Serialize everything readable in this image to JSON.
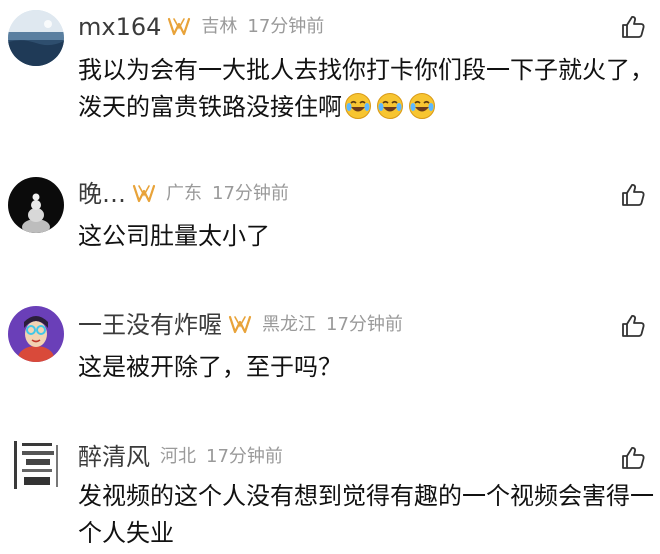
{
  "comments": [
    {
      "username": "mx164",
      "location": "吉林",
      "time": "17分钟前",
      "text": "我以为会有一大批人去找你打卡你们段一下子就火了，泼天的富贵铁路没接住啊",
      "emojis": [
        "laughing-crying-emoji",
        "laughing-crying-emoji",
        "laughing-crying-emoji"
      ]
    },
    {
      "username": "晚…",
      "location": "广东",
      "time": "17分钟前",
      "text": "这公司肚量太小了"
    },
    {
      "username": "一王没有炸喔",
      "location": "黑龙江",
      "time": "17分钟前",
      "text": "这是被开除了，至于吗？"
    },
    {
      "username": "醉清风",
      "location": "河北",
      "time": "17分钟前",
      "text": "发视频的这个人没有想到觉得有趣的一个视频会害得一个人失业"
    }
  ],
  "icons": {
    "badge": "vip-badge-icon",
    "like": "thumbs-up-icon"
  },
  "colors": {
    "username": "#3b3b3b",
    "meta": "#9a9a9a",
    "text": "#111111",
    "badge": "#e8a33a"
  }
}
